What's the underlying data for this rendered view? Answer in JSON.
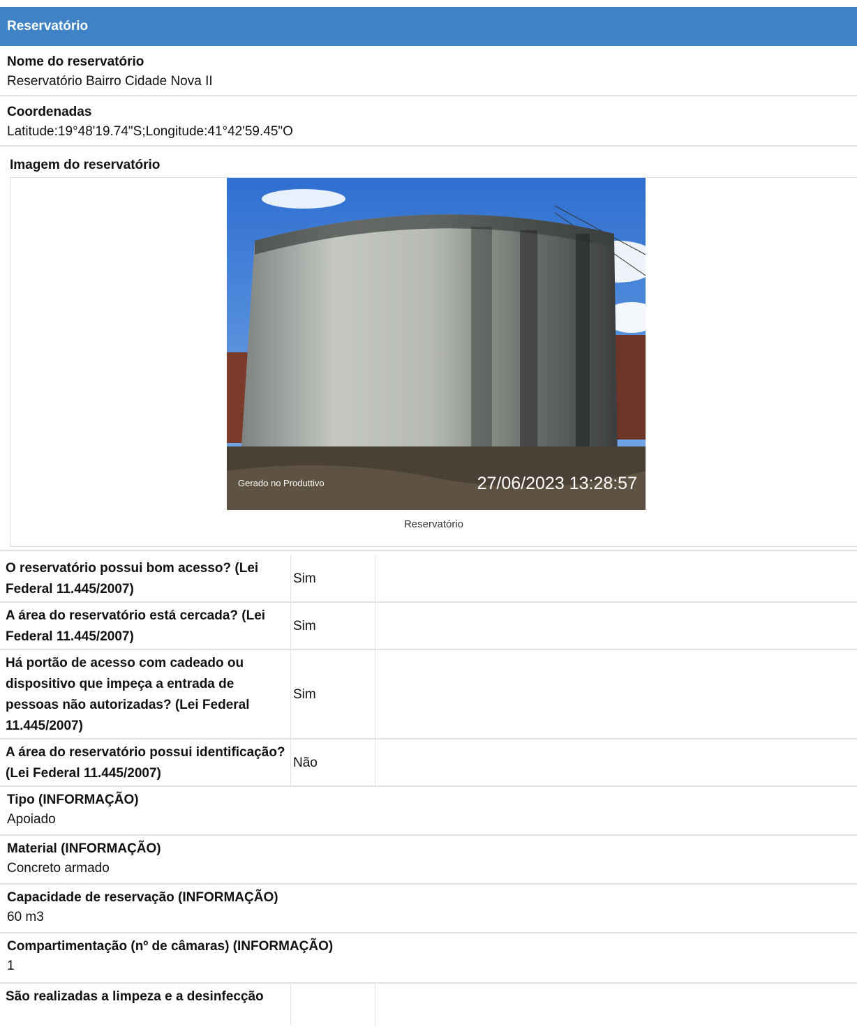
{
  "section": {
    "title": "Reservatório"
  },
  "nome": {
    "label": "Nome do reservatório",
    "value": "Reservatório Bairro Cidade Nova II"
  },
  "coordenadas": {
    "label": "Coordenadas",
    "value": "Latitude:19°48'19.74\"S;Longitude:41°42'59.45\"O"
  },
  "imagem": {
    "label": "Imagem do reservatório",
    "watermark_left": "Gerado no Produttivo",
    "timestamp": "27/06/2023 13:28:57",
    "caption": "Reservatório"
  },
  "questions": [
    {
      "question": "O reservatório possui bom acesso? (Lei Federal 11.445/2007)",
      "answer": "Sim"
    },
    {
      "question": "A área do reservatório está cercada? (Lei Federal 11.445/2007)",
      "answer": "Sim"
    },
    {
      "question": "Há portão de acesso com cadeado ou dispositivo que impeça a entrada de pessoas não autorizadas? (Lei Federal 11.445/2007)",
      "answer": "Sim"
    },
    {
      "question": "A área do reservatório possui identificação? (Lei Federal 11.445/2007)",
      "answer": "Não"
    }
  ],
  "tipo": {
    "label": "Tipo (INFORMAÇÃO)",
    "value": "Apoiado"
  },
  "material": {
    "label": "Material (INFORMAÇÃO)",
    "value": "Concreto armado"
  },
  "capacidade": {
    "label": "Capacidade de reservação (INFORMAÇÃO)",
    "value": "60 m3"
  },
  "compartimentacao": {
    "label": "Compartimentação (nº de câmaras) (INFORMAÇÃO)",
    "value": "1"
  },
  "last_question": {
    "question": "São realizadas a limpeza e a desinfecção"
  }
}
